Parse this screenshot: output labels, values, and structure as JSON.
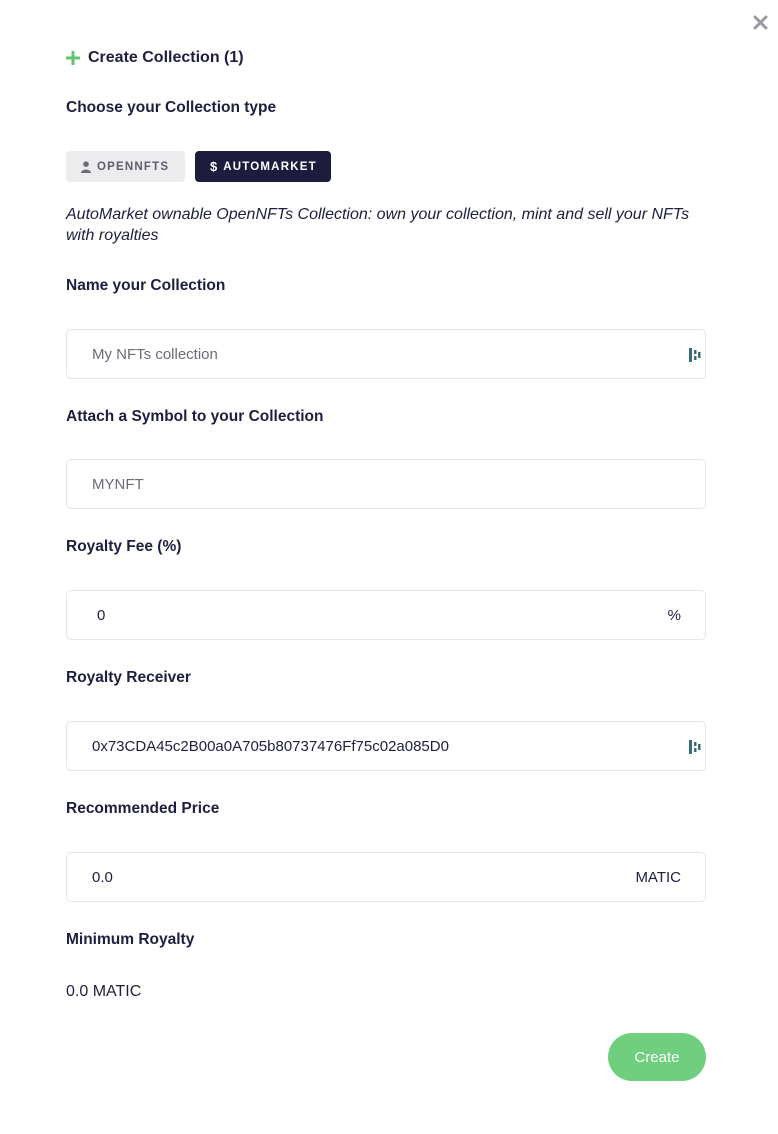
{
  "header": {
    "title": "Create Collection (1)",
    "icon": "plus-icon"
  },
  "close": {
    "icon": "close-icon"
  },
  "collection_type": {
    "label": "Choose your Collection type",
    "options": [
      {
        "label": "OPENNFTS",
        "icon": "user-icon",
        "selected": false
      },
      {
        "label": "AUTOMARKET",
        "icon": "dollar-icon",
        "selected": true
      }
    ],
    "description": "AutoMarket ownable OpenNFTs Collection: own your collection, mint and sell your NFTs with royalties"
  },
  "name_field": {
    "label": "Name your Collection",
    "placeholder": "My NFTs collection",
    "value": ""
  },
  "symbol_field": {
    "label": "Attach a Symbol to your Collection",
    "placeholder": "MYNFT",
    "value": ""
  },
  "royalty_fee": {
    "label": "Royalty Fee (%)",
    "value": "0",
    "suffix": "%"
  },
  "royalty_receiver": {
    "label": "Royalty Receiver",
    "value": "0x73CDA45c2B00a0A705b80737476Ff75c02a085D0"
  },
  "recommended_price": {
    "label": "Recommended Price",
    "value": "0.0",
    "suffix": "MATIC"
  },
  "minimum_royalty": {
    "label": "Minimum Royalty",
    "value": "0.0 MATIC"
  },
  "actions": {
    "create_label": "Create"
  },
  "colors": {
    "accent_green": "#6fcf7f",
    "dark_navy": "#1d1c3f",
    "field_border": "#e5e5ea"
  }
}
